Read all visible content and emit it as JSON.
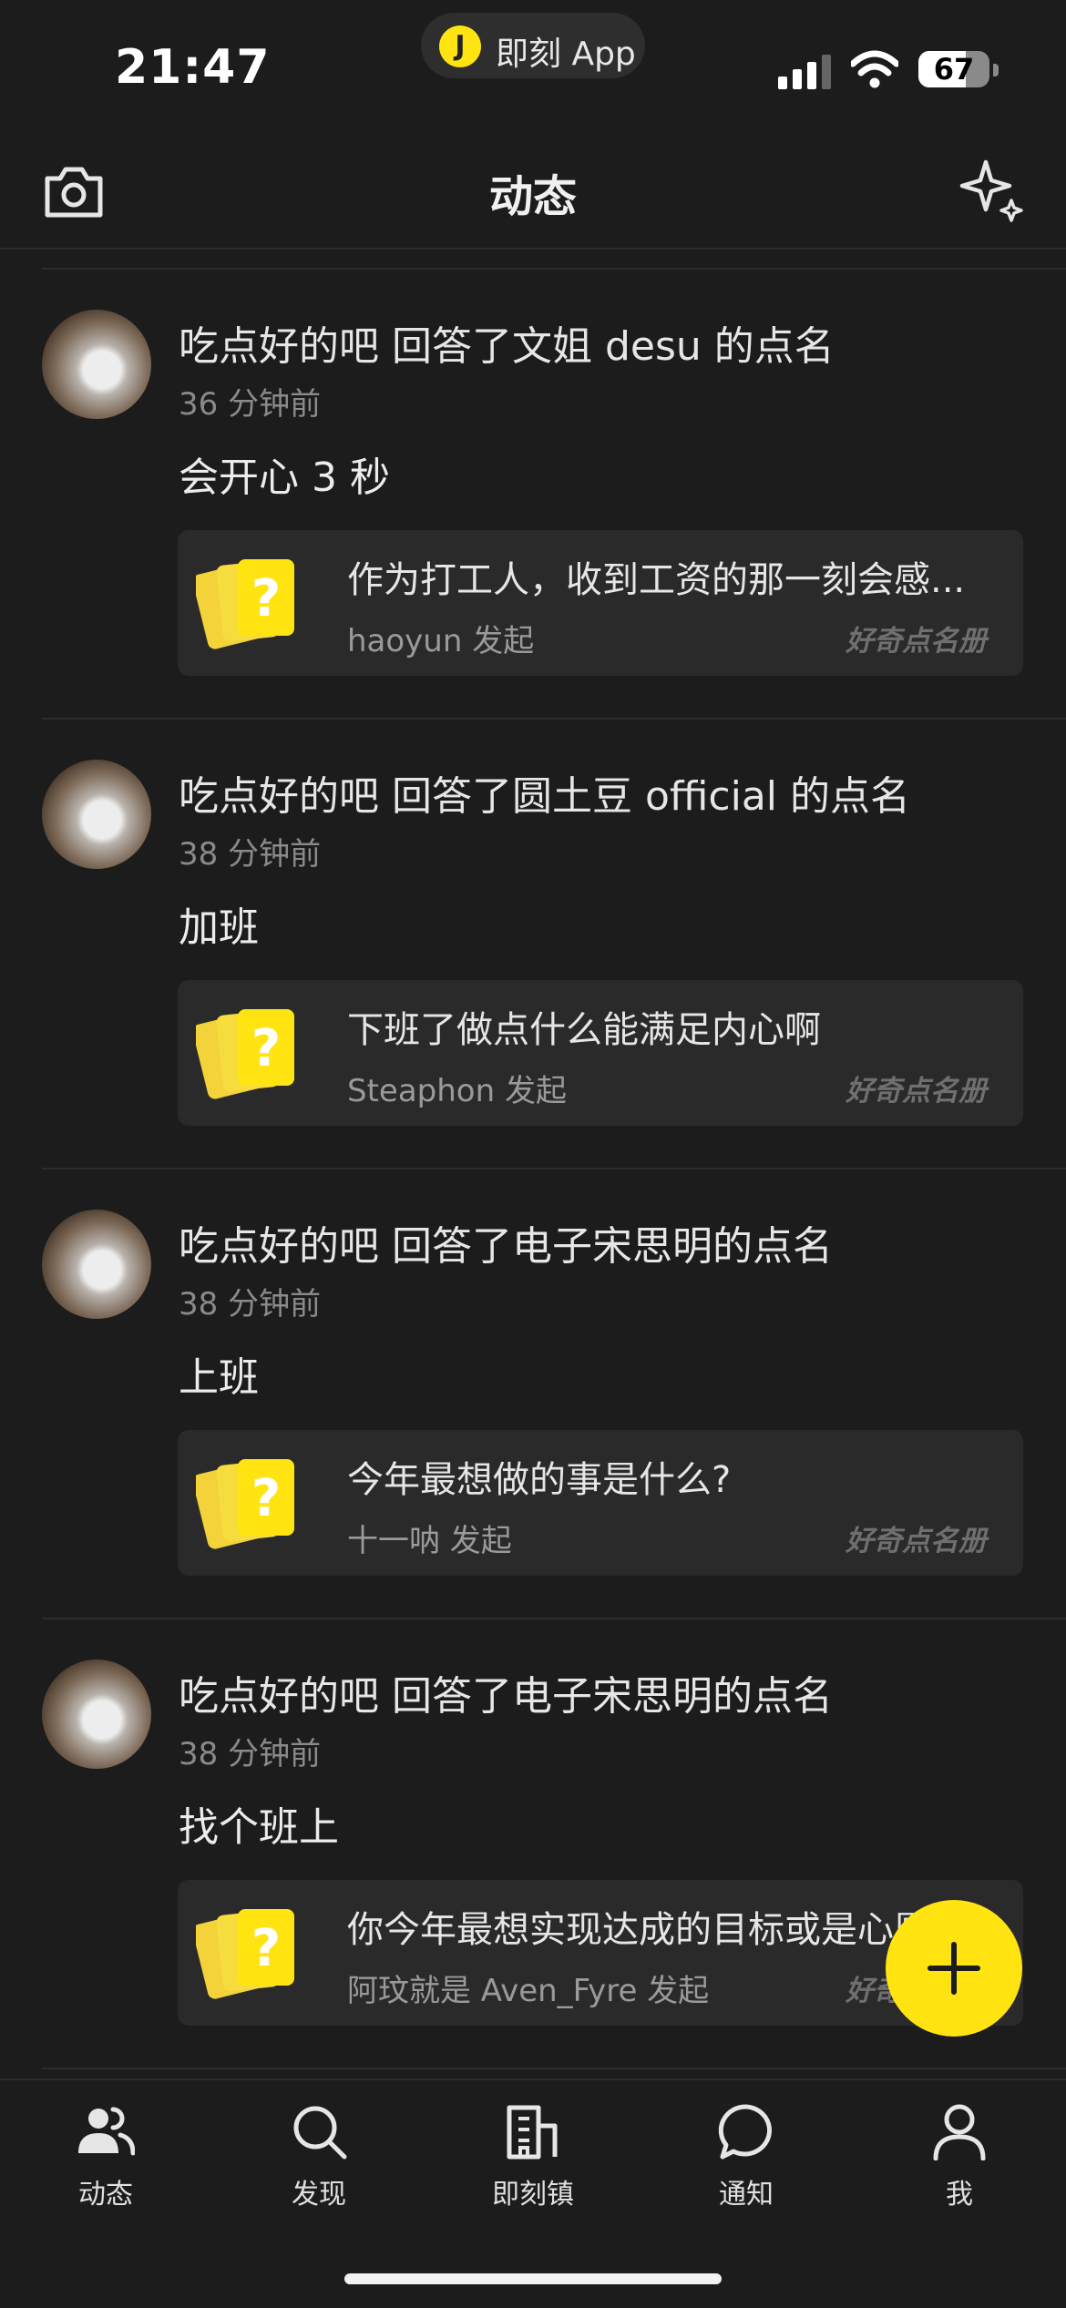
{
  "status_bar": {
    "time": "21:47",
    "app_pill": {
      "logo_glyph": "J",
      "label": "即刻 App"
    },
    "battery": {
      "level": 67,
      "label": "67"
    }
  },
  "nav": {
    "title": "动态",
    "left_icon": "camera-icon",
    "right_icon": "sparkle-icon"
  },
  "feed": [
    {
      "user": "吃点好的吧",
      "action": " 回答了文姐 desu 的点名",
      "time": "36 分钟前",
      "answer": "会开心 3 秒",
      "card": {
        "question": "作为打工人，收到工资的那一刻会感...",
        "initiator": "haoyun 发起",
        "source": "好奇点名册"
      }
    },
    {
      "user": "吃点好的吧",
      "action": " 回答了圆土豆 official 的点名",
      "time": "38 分钟前",
      "answer": "加班",
      "card": {
        "question": "下班了做点什么能满足内心啊",
        "initiator": "Steaphon 发起",
        "source": "好奇点名册"
      }
    },
    {
      "user": "吃点好的吧",
      "action": " 回答了电子宋思明的点名",
      "time": "38 分钟前",
      "answer": "上班",
      "card": {
        "question": "今年最想做的事是什么?",
        "initiator": "十一呐 发起",
        "source": "好奇点名册"
      }
    },
    {
      "user": "吃点好的吧",
      "action": " 回答了电子宋思明的点名",
      "time": "38 分钟前",
      "answer": "找个班上",
      "card": {
        "question": "你今年最想实现达成的目标或是心愿",
        "initiator": "阿玟就是 Aven_Fyre 发起",
        "source": "好奇点名册"
      }
    }
  ],
  "tabs": [
    {
      "label": "动态",
      "icon": "users-icon"
    },
    {
      "label": "发现",
      "icon": "search-icon"
    },
    {
      "label": "即刻镇",
      "icon": "building-icon"
    },
    {
      "label": "通知",
      "icon": "chat-bubble-icon"
    },
    {
      "label": "我",
      "icon": "person-icon"
    }
  ],
  "colors": {
    "background": "#1c1c1c",
    "card": "#2a2a2a",
    "accent": "#ffe411",
    "muted_text": "#8a8a8a"
  }
}
